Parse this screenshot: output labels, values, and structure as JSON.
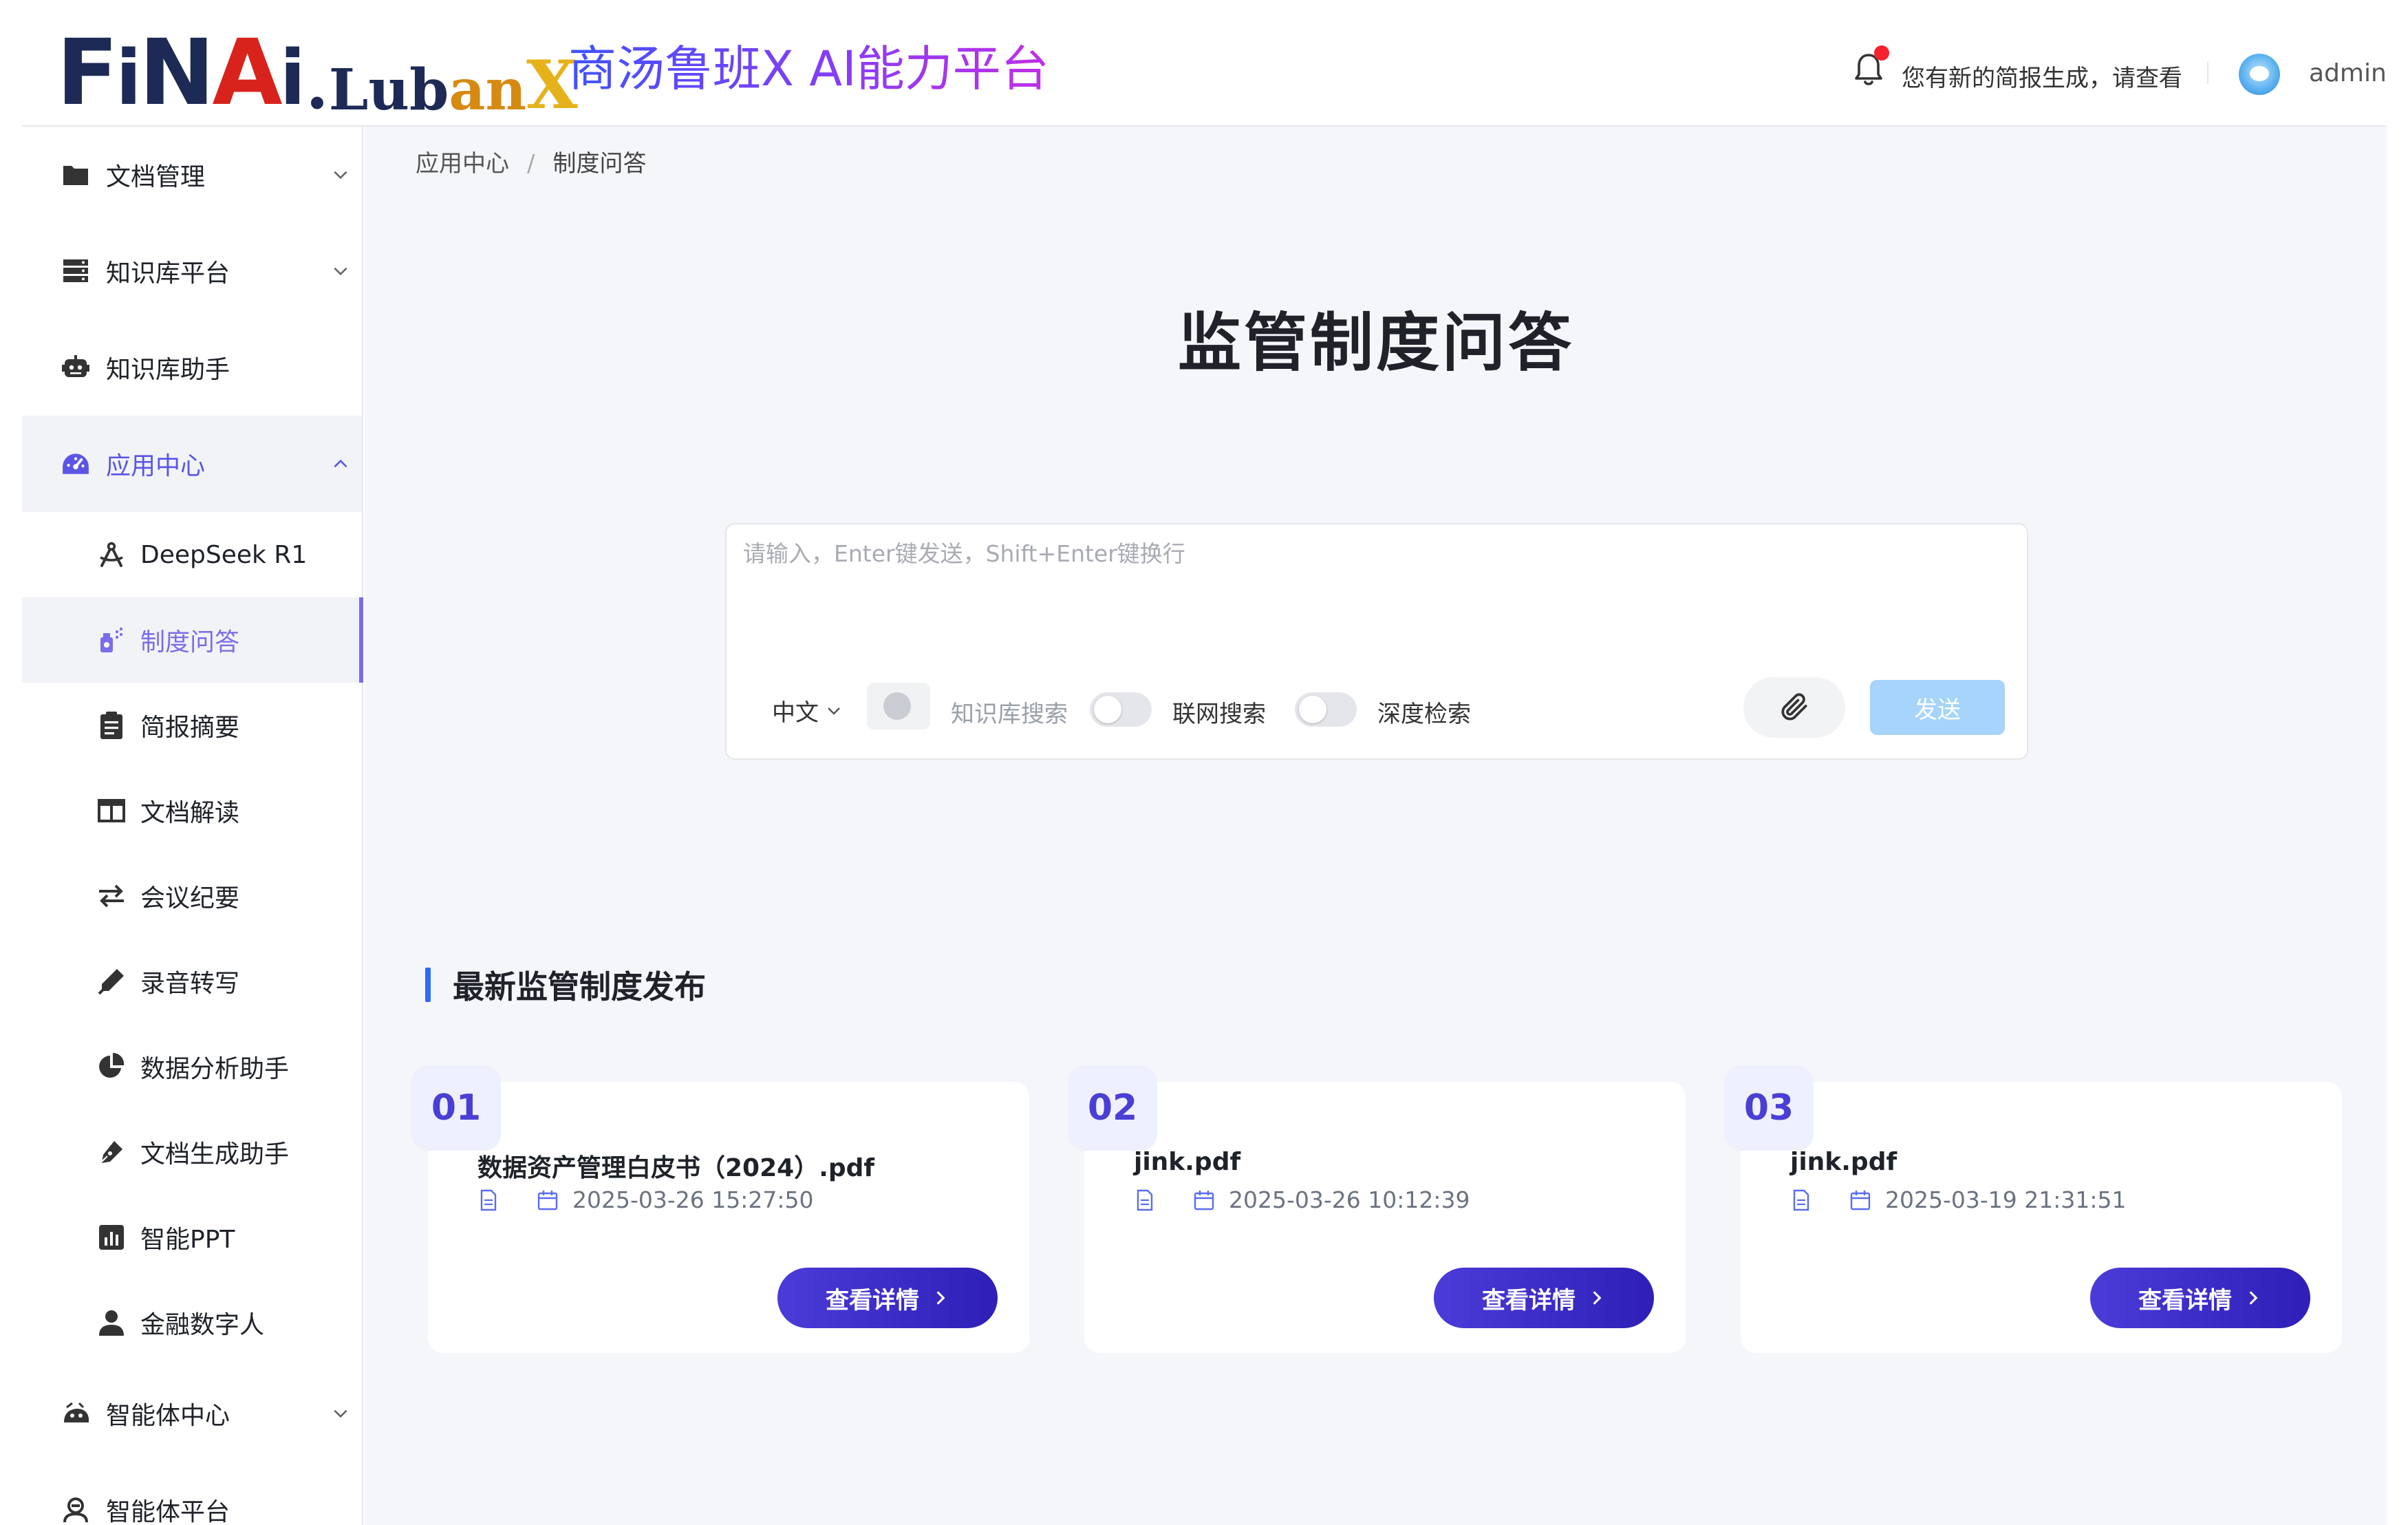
{
  "header": {
    "logo_text": "FiNAi.LubanX",
    "platform_title": "商汤鲁班X AI能力平台",
    "notification_text": "您有新的简报生成，请查看",
    "username": "admin",
    "notification_dot_color": "#f5222d"
  },
  "sidebar": {
    "items": [
      {
        "label": "文档管理",
        "icon": "folder-icon",
        "expanded": false
      },
      {
        "label": "知识库平台",
        "icon": "database-icon",
        "expanded": false
      },
      {
        "label": "知识库助手",
        "icon": "robot-icon"
      },
      {
        "label": "应用中心",
        "icon": "dashboard-icon",
        "expanded": true
      },
      {
        "label": "智能体中心",
        "icon": "agent-icon",
        "expanded": false
      },
      {
        "label": "智能体平台",
        "icon": "agent-platform-icon"
      }
    ],
    "sub_items": [
      {
        "label": "DeepSeek R1",
        "icon": "compass-icon"
      },
      {
        "label": "制度问答",
        "icon": "spray-icon",
        "active": true
      },
      {
        "label": "简报摘要",
        "icon": "clipboard-icon"
      },
      {
        "label": "文档解读",
        "icon": "columns-icon"
      },
      {
        "label": "会议纪要",
        "icon": "swap-icon"
      },
      {
        "label": "录音转写",
        "icon": "pen-icon"
      },
      {
        "label": "数据分析助手",
        "icon": "pie-chart-icon"
      },
      {
        "label": "文档生成助手",
        "icon": "pen-nib-icon"
      },
      {
        "label": "智能PPT",
        "icon": "bar-chart-icon"
      },
      {
        "label": "金融数字人",
        "icon": "user-icon"
      }
    ],
    "active_color": "#7b6cf0"
  },
  "breadcrumb": {
    "parent": "应用中心",
    "separator": "/",
    "current": "制度问答"
  },
  "main": {
    "title": "监管制度问答"
  },
  "chat": {
    "placeholder": "请输入，Enter键发送，Shift+Enter键换行",
    "language": "中文",
    "kb_search_label": "知识库搜索",
    "web_search_label": "联网搜索",
    "deep_search_label": "深度检索",
    "send_label": "发送",
    "send_color": "#a6d4fa"
  },
  "section": {
    "title": "最新监管制度发布",
    "accent_color": "#2f6af5"
  },
  "cards": [
    {
      "num": "01",
      "name": "数据资产管理白皮书（2024）.pdf",
      "date": "2025-03-26 15:27:50",
      "button": "查看详情"
    },
    {
      "num": "02",
      "name": "jink.pdf",
      "date": "2025-03-26 10:12:39",
      "button": "查看详情"
    },
    {
      "num": "03",
      "name": "jink.pdf",
      "date": "2025-03-19 21:31:51",
      "button": "查看详情"
    }
  ]
}
